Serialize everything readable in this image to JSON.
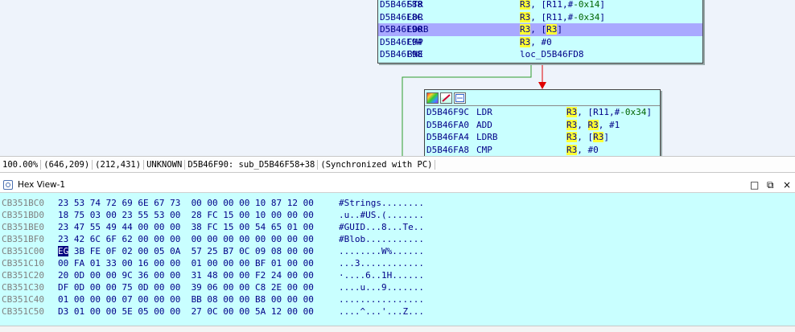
{
  "graph": {
    "top_node": {
      "lines": [
        {
          "addr": "D5B46F88",
          "mn": "STR",
          "ops": [
            [
              "reg",
              "R3"
            ],
            [
              "t",
              ", [R11,#"
            ],
            [
              "num",
              "-0x14"
            ],
            [
              "t",
              "]"
            ]
          ],
          "selected": false
        },
        {
          "addr": "D5B46F8C",
          "mn": "LDR",
          "ops": [
            [
              "reg",
              "R3"
            ],
            [
              "t",
              ", [R11,#"
            ],
            [
              "num",
              "-0x34"
            ],
            [
              "t",
              "]"
            ]
          ],
          "selected": false
        },
        {
          "addr": "D5B46F90",
          "mn": "LDRB",
          "ops": [
            [
              "reg",
              "R3"
            ],
            [
              "t",
              ", ["
            ],
            [
              "reg",
              "R3"
            ],
            [
              "t",
              "]"
            ]
          ],
          "selected": true
        },
        {
          "addr": "D5B46F94",
          "mn": "CMP",
          "ops": [
            [
              "reg",
              "R3"
            ],
            [
              "t",
              ", #0"
            ]
          ],
          "selected": false
        },
        {
          "addr": "D5B46F98",
          "mn": "BNE",
          "ops": [
            [
              "t",
              "loc_D5B46FD8"
            ]
          ],
          "selected": false
        }
      ]
    },
    "bottom_node": {
      "header_icons": [
        "color-palette-icon",
        "edit-node-icon",
        "graph-overview-icon"
      ],
      "lines": [
        {
          "addr": "D5B46F9C",
          "mn": "LDR",
          "ops": [
            [
              "reg",
              "R3"
            ],
            [
              "t",
              ", [R11,#"
            ],
            [
              "num",
              "-0x34"
            ],
            [
              "t",
              "]"
            ]
          ],
          "selected": false
        },
        {
          "addr": "D5B46FA0",
          "mn": "ADD",
          "ops": [
            [
              "reg",
              "R3"
            ],
            [
              "t",
              ", "
            ],
            [
              "reg",
              "R3"
            ],
            [
              "t",
              ", #1"
            ]
          ],
          "selected": false
        },
        {
          "addr": "D5B46FA4",
          "mn": "LDRB",
          "ops": [
            [
              "reg",
              "R3"
            ],
            [
              "t",
              ", ["
            ],
            [
              "reg",
              "R3"
            ],
            [
              "t",
              "]"
            ]
          ],
          "selected": false
        },
        {
          "addr": "D5B46FA8",
          "mn": "CMP",
          "ops": [
            [
              "reg",
              "R3"
            ],
            [
              "t",
              ", #0"
            ]
          ],
          "selected": false
        }
      ]
    }
  },
  "status": {
    "zoom": "100.00%",
    "coords1": "(646,209)",
    "coords2": "(212,431)",
    "segment": "UNKNOWN",
    "location": "D5B46F90: sub_D5B46F58+38",
    "sync": "(Synchronized with PC)"
  },
  "hex_view": {
    "title": "Hex View-1",
    "restore_glyph": "□",
    "float_glyph": "⧉",
    "close_glyph": "×",
    "cursor_row": 4,
    "cursor_byte": 0,
    "rows": [
      {
        "offset": "CB351BC0",
        "bytes": "23 53 74 72 69 6E 67 73  00 00 00 00 10 87 12 00",
        "text": "#Strings........"
      },
      {
        "offset": "CB351BD0",
        "bytes": "18 75 03 00 23 55 53 00  28 FC 15 00 10 00 00 00",
        "text": ".u..#US.(......."
      },
      {
        "offset": "CB351BE0",
        "bytes": "23 47 55 49 44 00 00 00  38 FC 15 00 54 65 01 00",
        "text": "#GUID...8...Te.."
      },
      {
        "offset": "CB351BF0",
        "bytes": "23 42 6C 6F 62 00 00 00  00 00 00 00 00 00 00 00",
        "text": "#Blob..........."
      },
      {
        "offset": "CB351C00",
        "bytes": "EG 3B FE 0F 02 00 05 0A  57 25 B7 0C 09 08 00 00",
        "text": "........W%......"
      },
      {
        "offset": "CB351C10",
        "bytes": "00 FA 01 33 00 16 00 00  01 00 00 00 BF 01 00 00",
        "text": "...3............"
      },
      {
        "offset": "CB351C20",
        "bytes": "20 0D 00 00 9C 36 00 00  31 48 00 00 F2 24 00 00",
        "text": "·....6..1H......"
      },
      {
        "offset": "CB351C30",
        "bytes": "DF 0D 00 00 75 0D 00 00  39 06 00 00 C8 2E 00 00",
        "text": "....u...9......."
      },
      {
        "offset": "CB351C40",
        "bytes": "01 00 00 00 07 00 00 00  BB 08 00 00 B8 00 00 00",
        "text": "................"
      },
      {
        "offset": "CB351C50",
        "bytes": "D3 01 00 00 5E 05 00 00  27 0C 00 00 5A 12 00 00",
        "text": "....^...'...Z..."
      }
    ]
  },
  "bottom_status_partial": "UNKNOWN CB351C00: [cut off, unreadable]"
}
